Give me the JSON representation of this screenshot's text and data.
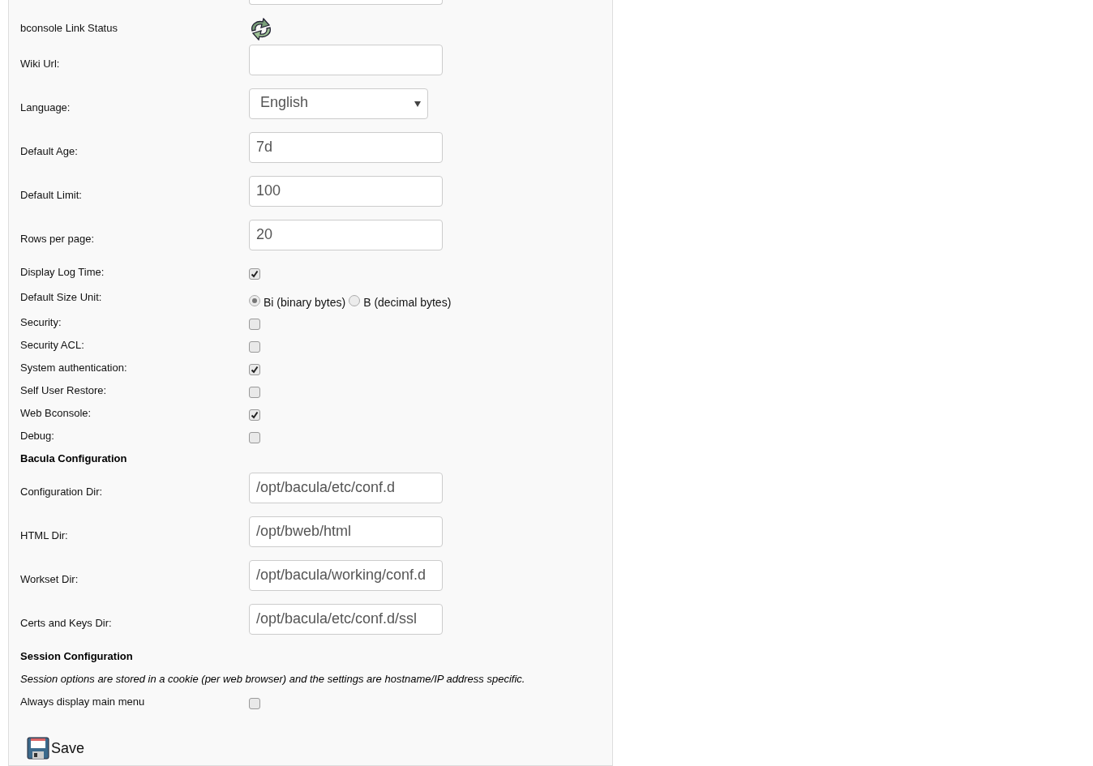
{
  "settings": [
    {
      "kind": "status",
      "label": "bconsole Link Status"
    },
    {
      "kind": "text",
      "label": "Wiki Url:"
    },
    {
      "kind": "select",
      "label": "Language:",
      "value": "English"
    },
    {
      "kind": "text",
      "label": "Default Age:",
      "value": "7d"
    },
    {
      "kind": "text",
      "label": "Default Limit:",
      "value": "100"
    },
    {
      "kind": "text",
      "label": "Rows per page:",
      "value": "20"
    },
    {
      "kind": "checkbox",
      "label": "Display Log Time:",
      "checked": true
    },
    {
      "kind": "radio",
      "label": "Default Size Unit:",
      "options": [
        {
          "label": "Bi (binary bytes)",
          "selected": true
        },
        {
          "label": "B (decimal bytes)",
          "selected": false
        }
      ]
    },
    {
      "kind": "checkbox",
      "label": "Security:",
      "checked": false
    },
    {
      "kind": "checkbox",
      "label": "Security ACL:",
      "checked": false
    },
    {
      "kind": "checkbox",
      "label": "System authentication:",
      "checked": true
    },
    {
      "kind": "checkbox",
      "label": "Self User Restore:",
      "checked": false
    },
    {
      "kind": "checkbox",
      "label": "Web Bconsole:",
      "checked": true
    },
    {
      "kind": "checkbox",
      "label": "Debug:",
      "checked": false
    },
    {
      "kind": "heading",
      "text": "Bacula Configuration"
    },
    {
      "kind": "text",
      "label": "Configuration Dir:",
      "value": "/opt/bacula/etc/conf.d"
    },
    {
      "kind": "text",
      "label": "HTML Dir:",
      "value": "/opt/bweb/html"
    },
    {
      "kind": "text",
      "label": "Workset Dir:",
      "value": "/opt/bacula/working/conf.d"
    },
    {
      "kind": "text",
      "label": "Certs and Keys Dir:",
      "value": "/opt/bacula/etc/conf.d/ssl"
    },
    {
      "kind": "heading",
      "text": "Session Configuration"
    },
    {
      "kind": "note",
      "text": "Session options are stored in a cookie (per web browser) and the settings are hostname/IP address specific."
    },
    {
      "kind": "checkbox",
      "label": "Always display main menu",
      "checked": false
    }
  ],
  "save_button": {
    "label": "Save"
  }
}
